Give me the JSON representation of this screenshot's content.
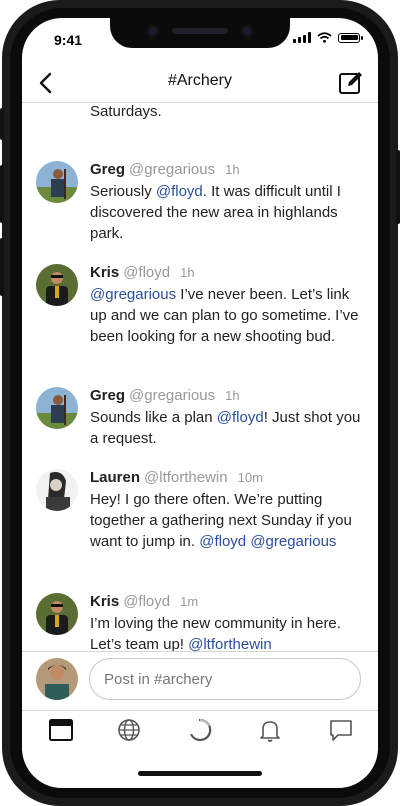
{
  "status": {
    "time": "9:41"
  },
  "nav": {
    "title": "#Archery",
    "back_icon": "chevron-left-icon",
    "compose_icon": "compose-icon"
  },
  "feed": {
    "cut_text": "Saturdays.",
    "posts": [
      {
        "name": "Greg",
        "handle": "@gregarious",
        "time": "1h",
        "segments": [
          {
            "t": "Seriously "
          },
          {
            "t": "@floyd",
            "m": true
          },
          {
            "t": ". It was difficult until I discovered the new area in highlands park."
          }
        ]
      },
      {
        "name": "Kris",
        "handle": "@floyd",
        "time": "1h",
        "segments": [
          {
            "t": "@gregarious",
            "m": true
          },
          {
            "t": " I’ve never been. Let’s link up and we can plan to go sometime. I’ve been looking for a new shooting bud."
          }
        ]
      },
      {
        "name": "Greg",
        "handle": "@gregarious",
        "time": "1h",
        "segments": [
          {
            "t": "Sounds like a plan "
          },
          {
            "t": "@floyd",
            "m": true
          },
          {
            "t": "! Just shot you a request."
          }
        ]
      },
      {
        "name": "Lauren",
        "handle": "@ltforthewin",
        "time": "10m",
        "segments": [
          {
            "t": "Hey! I go there often. We’re putting together a gathering next Sunday if you want to jump in. "
          },
          {
            "t": "@floyd",
            "m": true
          },
          {
            "t": " "
          },
          {
            "t": "@gregarious",
            "m": true
          }
        ]
      },
      {
        "name": "Kris",
        "handle": "@floyd",
        "time": "1m",
        "segments": [
          {
            "t": "I’m loving the new community in here. Let’s team up! "
          },
          {
            "t": "@ltforthewin",
            "m": true
          }
        ]
      }
    ]
  },
  "composer": {
    "placeholder": "Post in #archery"
  },
  "tabs": [
    "feed-icon",
    "globe-icon",
    "activity-spinner-icon",
    "bell-icon",
    "chat-bubble-icon"
  ],
  "colors": {
    "mention": "#2a4fa0",
    "meta": "#999999",
    "divider": "#d6d6d6"
  }
}
